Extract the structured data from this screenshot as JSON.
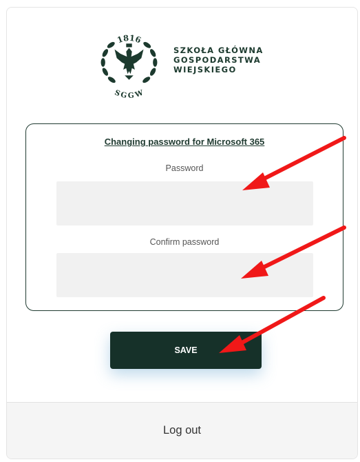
{
  "logo": {
    "year": "1816",
    "initials": "SGGW",
    "name_lines": [
      "SZKOŁA GŁÓWNA",
      "GOSPODARSTWA",
      "WIEJSKIEGO"
    ]
  },
  "form": {
    "title": "Changing password for Microsoft 365",
    "password_label": "Password",
    "confirm_label": "Confirm password",
    "password_value": "",
    "confirm_value": ""
  },
  "actions": {
    "save_label": "SAVE",
    "logout_label": "Log out"
  },
  "colors": {
    "brand_dark_green": "#163129",
    "annotation_red": "#f01818",
    "input_background": "#f1f1f1"
  }
}
